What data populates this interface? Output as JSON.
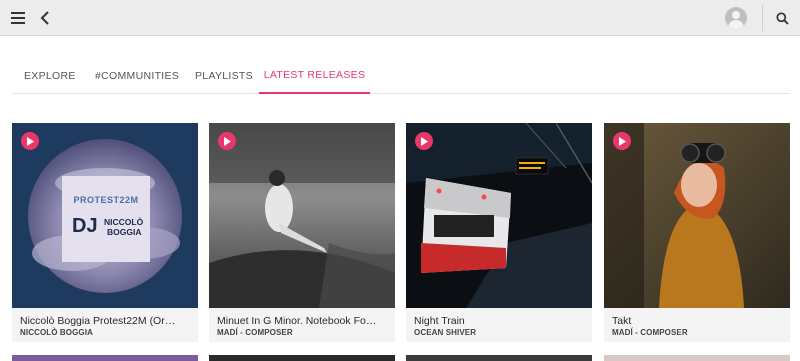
{
  "tabs": [
    {
      "label": "EXPLORE"
    },
    {
      "label": "#COMMUNITIES"
    },
    {
      "label": "PLAYLISTS"
    },
    {
      "label": "LATEST RELEASES"
    }
  ],
  "active_tab": "LATEST RELEASES",
  "accent_color": "#e8386b",
  "cards": [
    {
      "title": "Niccolò Boggia Protest22M (Or…",
      "artist": "NICCOLÒ BOGGIA",
      "art_text": {
        "top": "PROTEST22M",
        "dj": "DJ",
        "name1": "NICCOLÒ",
        "name2": "BOGGIA"
      }
    },
    {
      "title": "Minuet In G Minor. Notebook Fo…",
      "artist": "MADÍ - COMPOSER"
    },
    {
      "title": "Night Train",
      "artist": "OCEAN SHIVER"
    },
    {
      "title": "Takt",
      "artist": "MADÍ - COMPOSER"
    }
  ],
  "icons": {
    "menu": "hamburger-icon",
    "back": "chevron-left-icon",
    "avatar": "user-avatar-icon",
    "search": "search-icon",
    "play": "play-icon"
  }
}
